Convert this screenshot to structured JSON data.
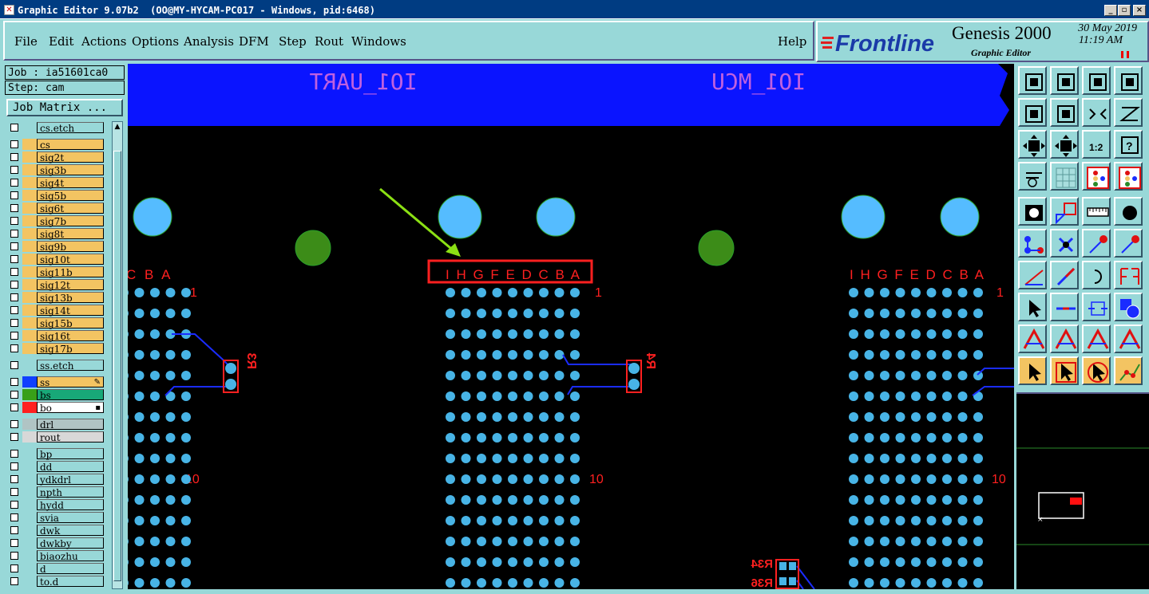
{
  "window": {
    "title": "Graphic Editor 9.07b2  (OO@MY-HYCAM-PC017 - Windows, pid:6468)",
    "minimize": "_",
    "restore": "▫",
    "close": "×"
  },
  "menu": {
    "items": [
      "File",
      "Edit",
      "Actions",
      "Options",
      "Analysis",
      "DFM",
      "Step",
      "Rout",
      "Windows"
    ],
    "help": "Help"
  },
  "brand": {
    "logo": "Frontline",
    "product": "Genesis 2000",
    "subtitle": "Graphic Editor",
    "date": "30 May 2019",
    "time": "11:19 AM"
  },
  "job": {
    "job_line": "Job : ia51601ca0",
    "step_line": "Step: cam",
    "matrix_button": "Job Matrix ..."
  },
  "layers": [
    {
      "name": "cs.etch",
      "color": "#98d8d8"
    },
    {
      "name": "cs",
      "color": "#f3c462"
    },
    {
      "name": "sig2t",
      "color": "#f3c462"
    },
    {
      "name": "sig3b",
      "color": "#f3c462"
    },
    {
      "name": "sig4t",
      "color": "#f3c462"
    },
    {
      "name": "sig5b",
      "color": "#f3c462"
    },
    {
      "name": "sig6t",
      "color": "#f3c462"
    },
    {
      "name": "sig7b",
      "color": "#f3c462"
    },
    {
      "name": "sig8t",
      "color": "#f3c462"
    },
    {
      "name": "sig9b",
      "color": "#f3c462"
    },
    {
      "name": "sig10t",
      "color": "#f3c462"
    },
    {
      "name": "sig11b",
      "color": "#f3c462"
    },
    {
      "name": "sig12t",
      "color": "#f3c462"
    },
    {
      "name": "sig13b",
      "color": "#f3c462"
    },
    {
      "name": "sig14t",
      "color": "#f3c462"
    },
    {
      "name": "sig15b",
      "color": "#f3c462"
    },
    {
      "name": "sig16t",
      "color": "#f3c462"
    },
    {
      "name": "sig17b",
      "color": "#f3c462"
    },
    {
      "name": "ss.etch",
      "color": "#98d8d8"
    },
    {
      "name": "ss",
      "color": "#f3c462",
      "swatch": "#1040ff",
      "mark": "✎"
    },
    {
      "name": "bs",
      "color": "#18a878",
      "swatch": "#38a018"
    },
    {
      "name": "bo",
      "color": "#ffffff",
      "swatch": "#ff2020",
      "mark": "▪"
    },
    {
      "name": "drl",
      "color": "#b0c4c4"
    },
    {
      "name": "rout",
      "color": "#d8d8d8"
    },
    {
      "name": "bp",
      "color": "#98d8d8"
    },
    {
      "name": "dd",
      "color": "#98d8d8"
    },
    {
      "name": "ydkdrl",
      "color": "#98d8d8"
    },
    {
      "name": "npth",
      "color": "#98d8d8"
    },
    {
      "name": "hydd",
      "color": "#98d8d8"
    },
    {
      "name": "svia",
      "color": "#98d8d8"
    },
    {
      "name": "dwk",
      "color": "#98d8d8"
    },
    {
      "name": "dwkby",
      "color": "#98d8d8"
    },
    {
      "name": "biaozhu",
      "color": "#98d8d8"
    },
    {
      "name": "d",
      "color": "#98d8d8"
    },
    {
      "name": "to.d",
      "color": "#98d8d8"
    }
  ],
  "canvas": {
    "labels": {
      "uart": "IO1_UART",
      "mcu": "IO1_MCU",
      "cols_left": "C B A",
      "cols_mid": "I H G F E D C B A",
      "cols_right": "I H G F E D C B A",
      "row1": "1",
      "row10": "10",
      "r3": "R3",
      "r4": "R4",
      "r34": "R34",
      "r36": "R36"
    },
    "colors": {
      "banner": "#0a14ff",
      "pad": "#48b4e6",
      "hole_light": "#55bcff",
      "hole_green": "#3c8c18",
      "text_red": "#ff2020",
      "trace": "#1a2cff",
      "arrow": "#8be014"
    }
  },
  "toolbar": {
    "rows": [
      [
        "open-job-icon",
        "save-icon",
        "home-icon",
        "window-icon"
      ],
      [
        "zoom-left-icon",
        "zoom-right-icon",
        "swap-icon",
        "step-icon"
      ],
      [
        "fit-icon",
        "center-icon",
        "scale-1-2-icon",
        "help-icon"
      ],
      [
        "tools-icon",
        "grid-icon",
        "layer-left-icon",
        "layer-right-icon"
      ],
      [
        "snapshot-icon",
        "measure-icon",
        "ruler-icon",
        "record-icon"
      ],
      [
        "connect-icon",
        "cross-icon",
        "add-point-icon",
        "move-point-icon"
      ],
      [
        "line-icon",
        "slash-icon",
        "undo-icon",
        "flip-icon"
      ],
      [
        "select-icon",
        "minus-icon",
        "snap-icon",
        "shapes-icon"
      ],
      [
        "triangle-a-icon",
        "triangle-b-icon",
        "triangle-c-icon",
        "triangle-d-icon"
      ],
      [
        "pointer-icon",
        "pointer-box-icon",
        "pointer-circle-icon",
        "route-icon"
      ]
    ],
    "scale_label": "1:2"
  }
}
